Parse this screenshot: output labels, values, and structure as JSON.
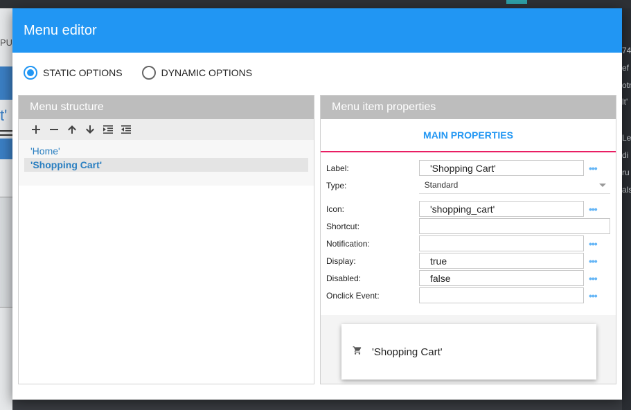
{
  "background": {
    "left_texts": [
      "PU",
      "t'"
    ],
    "right_texts": [
      "74",
      "ef",
      "otn",
      "lt'",
      "Le",
      "di",
      "ru",
      "als"
    ]
  },
  "dialog": {
    "title": "Menu editor",
    "options": [
      {
        "label": "STATIC OPTIONS",
        "selected": true
      },
      {
        "label": "DYNAMIC OPTIONS",
        "selected": false
      }
    ]
  },
  "menu_structure": {
    "title": "Menu structure",
    "toolbar": [
      "add-icon",
      "remove-icon",
      "move-up-icon",
      "move-down-icon",
      "indent-icon",
      "outdent-icon"
    ],
    "items": [
      {
        "label": "'Home'",
        "selected": false
      },
      {
        "label": "'Shopping Cart'",
        "selected": true
      }
    ]
  },
  "properties": {
    "title": "Menu item properties",
    "tab": "MAIN PROPERTIES",
    "label": {
      "name": "Label:",
      "value": "'Shopping Cart'"
    },
    "type": {
      "name": "Type:",
      "value": "Standard"
    },
    "icon": {
      "name": "Icon:",
      "value": "'shopping_cart'"
    },
    "shortcut": {
      "name": "Shortcut:",
      "value": ""
    },
    "notification": {
      "name": "Notification:",
      "value": ""
    },
    "display": {
      "name": "Display:",
      "value": "true"
    },
    "disabled": {
      "name": "Disabled:",
      "value": "false"
    },
    "onclick": {
      "name": "Onclick Event:",
      "value": ""
    },
    "more_glyph": "•••"
  },
  "preview": {
    "icon": "shopping-cart-icon",
    "label": "'Shopping Cart'"
  },
  "colors": {
    "accent": "#2196f3",
    "tab_underline": "#e91e63"
  }
}
